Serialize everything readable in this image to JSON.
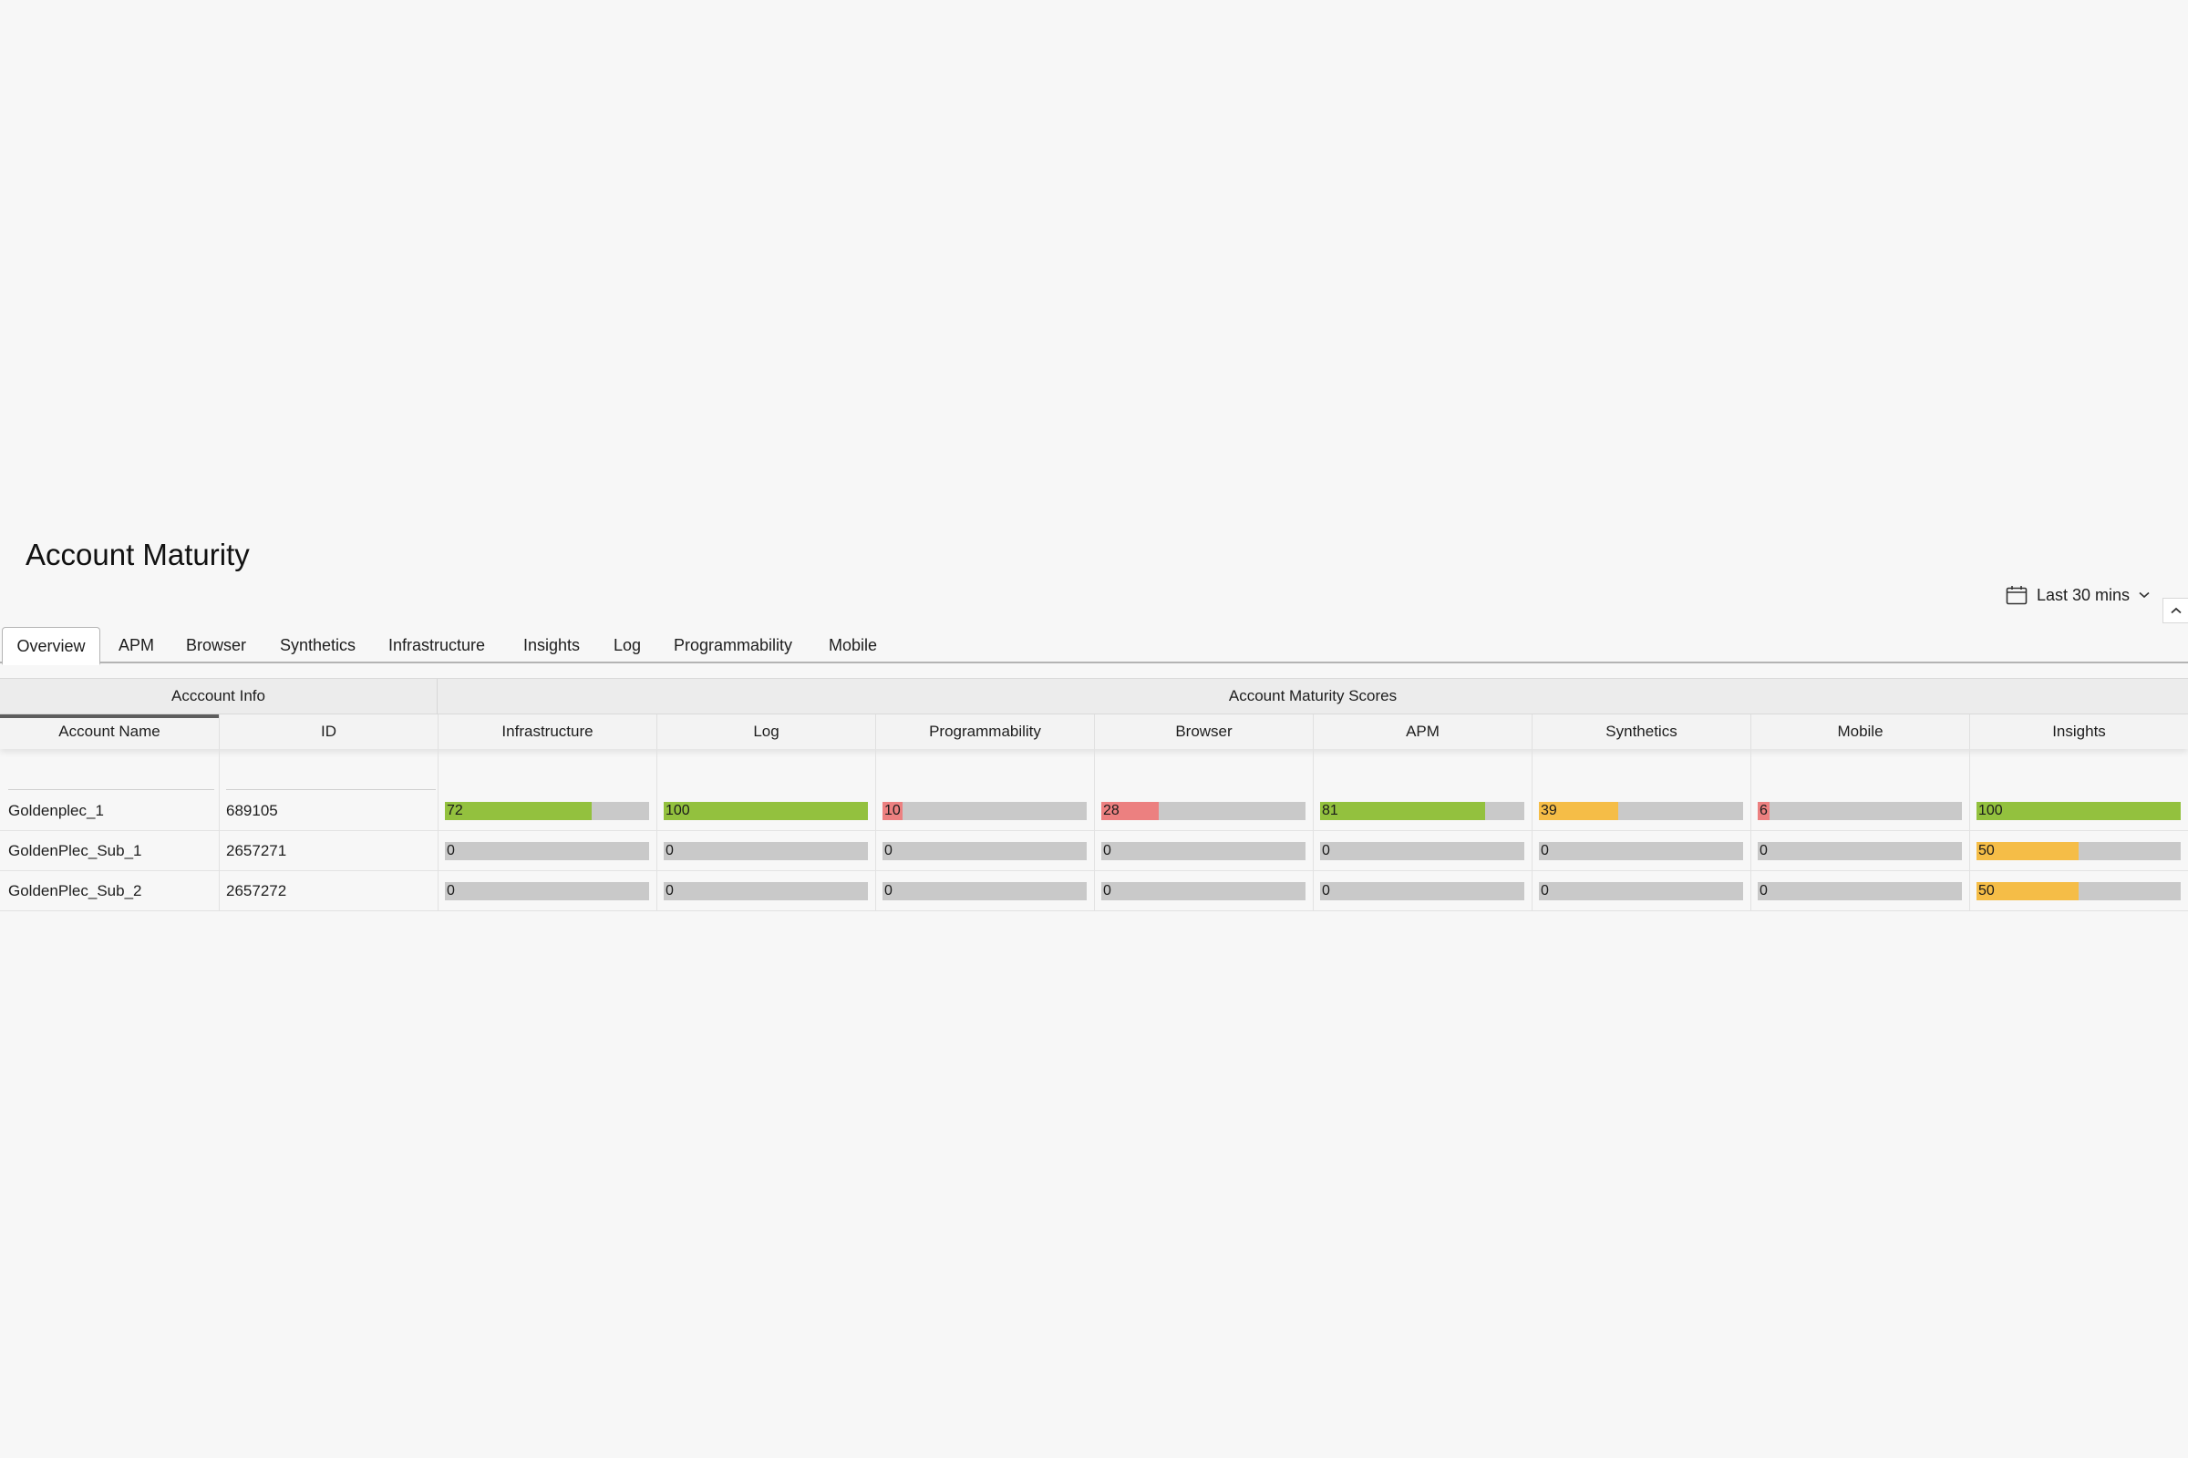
{
  "page": {
    "title": "Account Maturity"
  },
  "time_picker": {
    "label": "Last 30 mins",
    "icon": "calendar-icon"
  },
  "colors": {
    "green": "#93c13e",
    "red": "#ec8080",
    "yellow": "#f5bd47",
    "track": "#c9c9c9"
  },
  "tabs": [
    {
      "label": "Overview",
      "active": true
    },
    {
      "label": "APM"
    },
    {
      "label": "Browser"
    },
    {
      "label": "Synthetics"
    },
    {
      "label": "Infrastructure"
    },
    {
      "label": "Insights"
    },
    {
      "label": "Log"
    },
    {
      "label": "Programmability"
    },
    {
      "label": "Mobile"
    }
  ],
  "table": {
    "groups": {
      "info": "Acccount Info",
      "scores": "Account Maturity Scores"
    },
    "columns": [
      "Account Name",
      "ID",
      "Infrastructure",
      "Log",
      "Programmability",
      "Browser",
      "APM",
      "Synthetics",
      "Mobile",
      "Insights"
    ],
    "rows": [
      {
        "name": "Goldenplec_1",
        "id": "689105",
        "scores": [
          72,
          100,
          10,
          28,
          81,
          39,
          6,
          100
        ]
      },
      {
        "name": "GoldenPlec_Sub_1",
        "id": "2657271",
        "scores": [
          0,
          0,
          0,
          0,
          0,
          0,
          0,
          50
        ]
      },
      {
        "name": "GoldenPlec_Sub_2",
        "id": "2657272",
        "scores": [
          0,
          0,
          0,
          0,
          0,
          0,
          0,
          50
        ]
      }
    ]
  }
}
